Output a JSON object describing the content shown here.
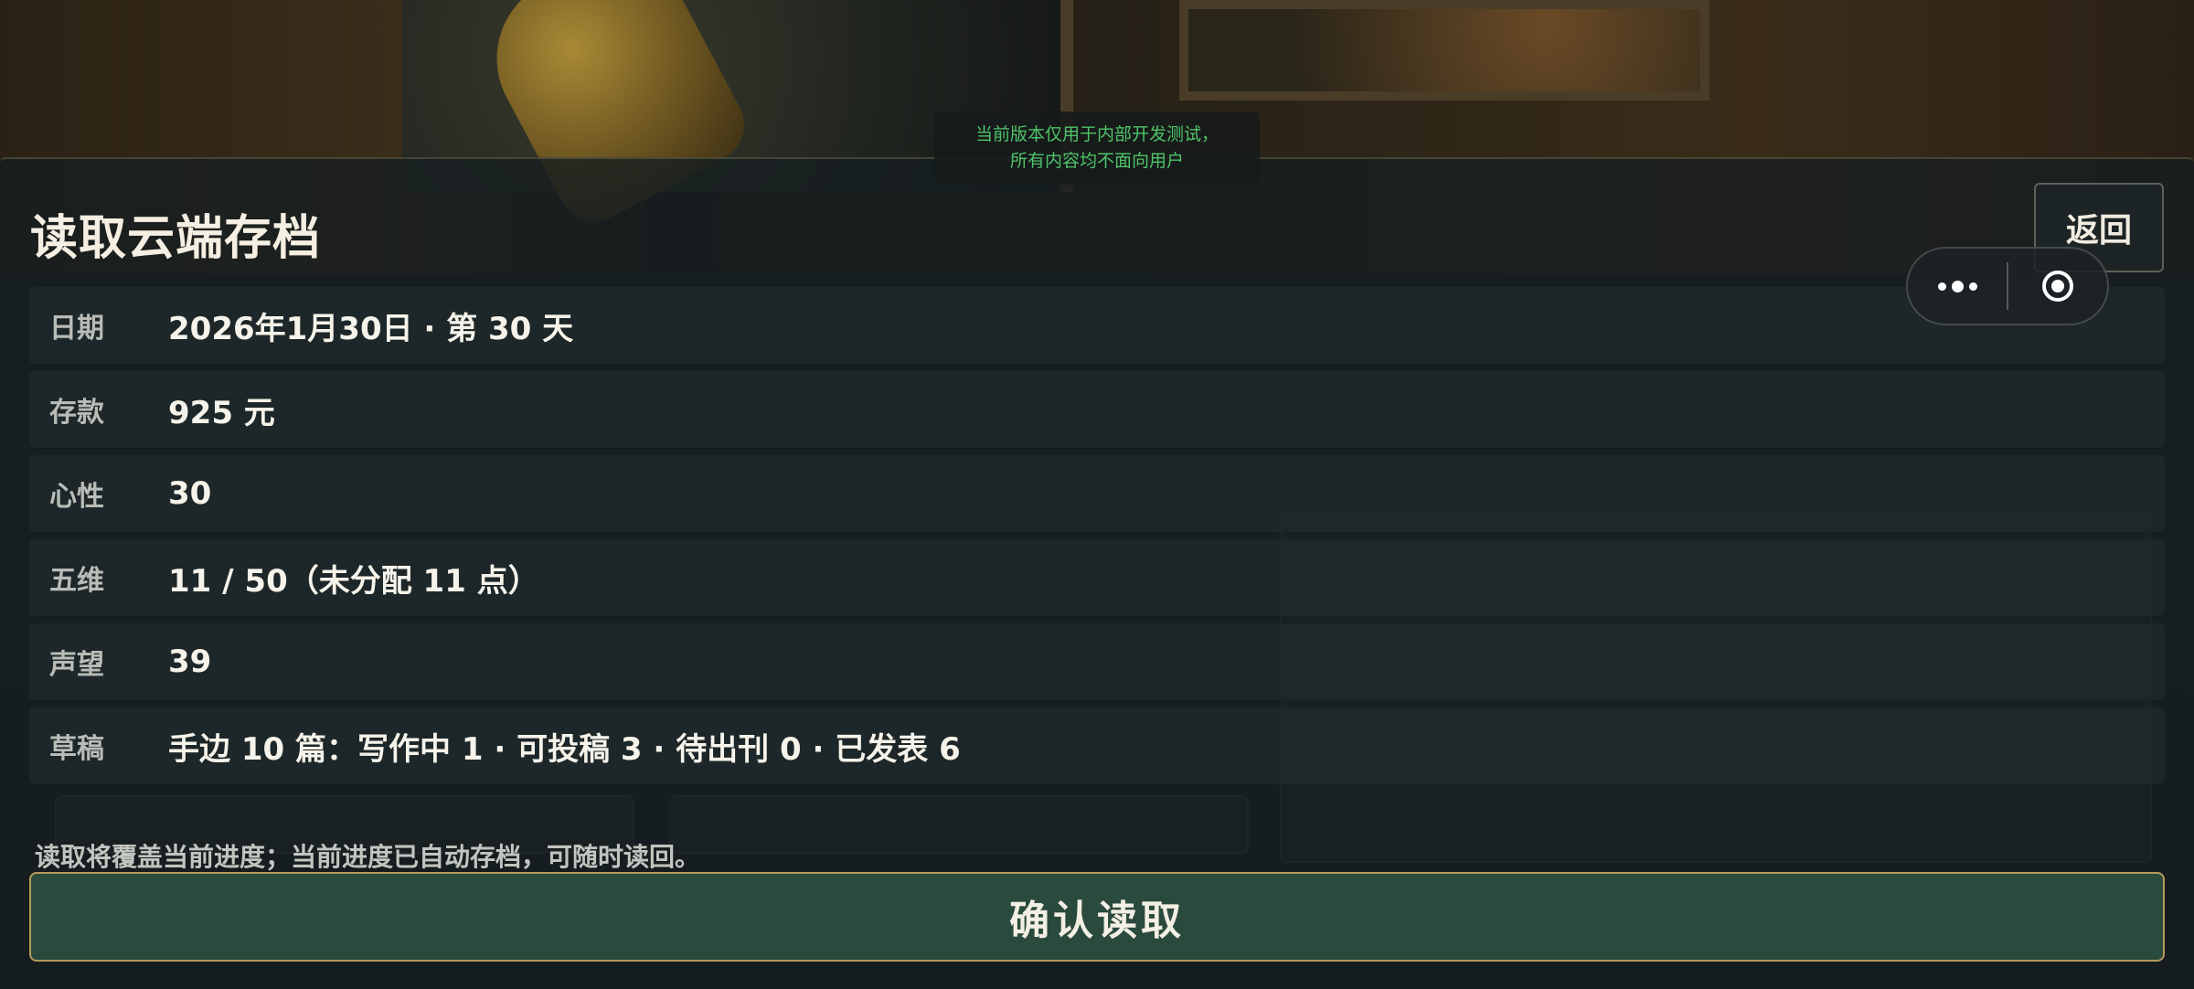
{
  "dev_notice": {
    "line1": "当前版本仅用于内部开发测试，",
    "line2": "所有内容均不面向用户"
  },
  "dialog": {
    "title": "读取云端存档",
    "back_label": "返回",
    "rows": [
      {
        "label": "日期",
        "value": "2026年1月30日 · 第 30 天"
      },
      {
        "label": "存款",
        "value": "925 元"
      },
      {
        "label": "心性",
        "value": " 30"
      },
      {
        "label": "五维",
        "value": "11 / 50（未分配 11 点）"
      },
      {
        "label": "声望",
        "value": " 39"
      },
      {
        "label": "草稿",
        "value": "手边 10 篇：写作中 1 · 可投稿 3 · 待出刊 0 · 已发表 6"
      }
    ],
    "note": "读取将覆盖当前进度；当前进度已自动存档，可随时读回。",
    "confirm_label": "确认读取"
  },
  "capsule": {
    "more_icon": "more-dots-icon",
    "close_icon": "target-close-icon"
  },
  "colors": {
    "confirm_bg": "#2b4a3e",
    "confirm_border": "#b69a5a",
    "dev_notice_text": "#4fc46a"
  }
}
